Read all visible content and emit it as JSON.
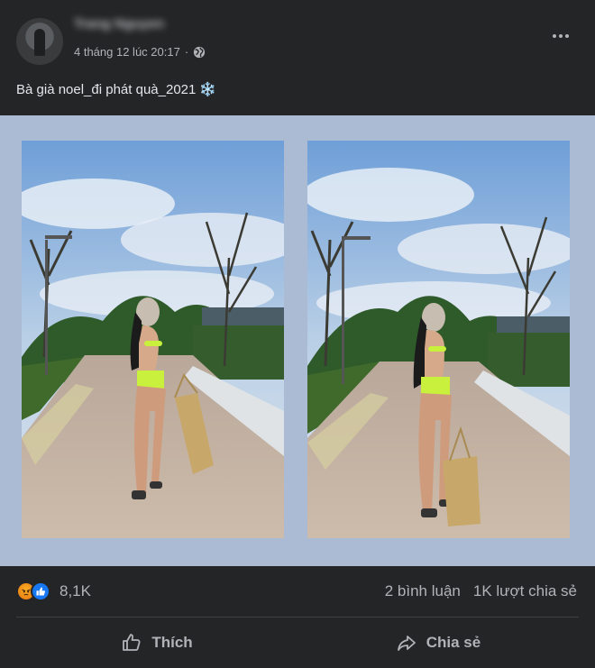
{
  "post": {
    "author_name": "Trang Nguyen",
    "timestamp": "4 tháng 12 lúc 20:17",
    "privacy_separator": "·",
    "privacy_icon": "globe-icon",
    "caption": "Bà già noel_đi phát quà_2021",
    "caption_emoji": "❄️"
  },
  "photos": [
    {
      "name": "photo-left",
      "icon": "photo"
    },
    {
      "name": "photo-right",
      "icon": "photo"
    }
  ],
  "reactions": {
    "icons": [
      "angry-icon",
      "like-react-icon"
    ],
    "count": "8,1K",
    "comments": "2 bình luận",
    "shares": "1K lượt chia sẻ"
  },
  "actions": {
    "like_label": "Thích",
    "share_label": "Chia sẻ"
  },
  "colors": {
    "card_bg": "#242526",
    "photo_frame_bg": "#aabbd3",
    "text_primary": "#e4e6eb",
    "text_secondary": "#b0b3b8",
    "like_blue": "#1877f2"
  }
}
